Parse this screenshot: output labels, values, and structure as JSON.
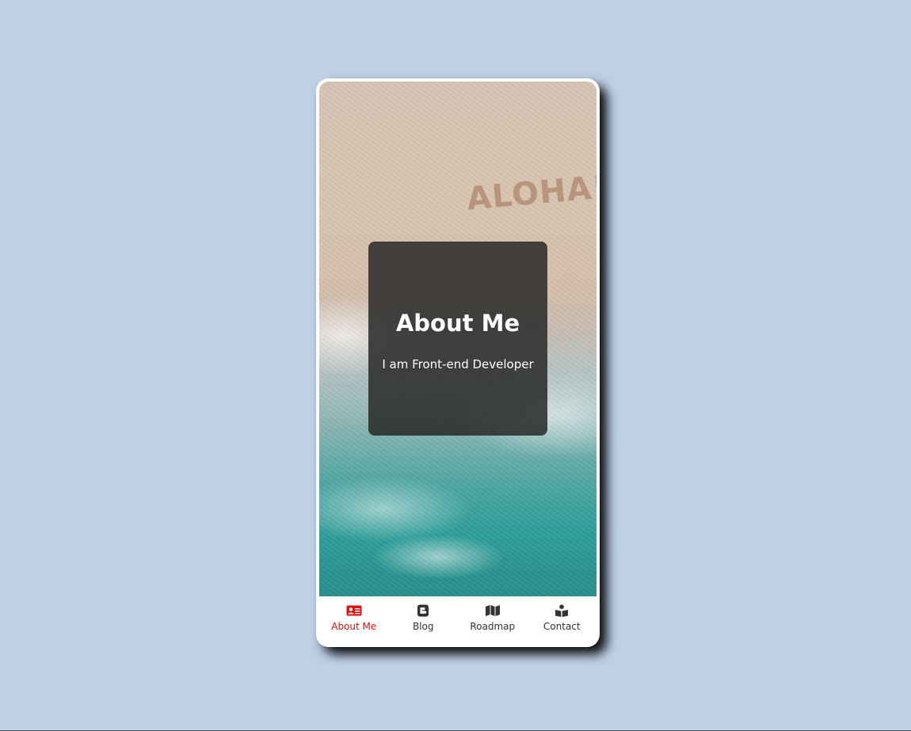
{
  "background_color": "#bfd0e6",
  "accent_color": "#e01010",
  "hero": {
    "image_text": "ALOHA!",
    "title": "About Me",
    "subtitle": "I am Front-end Developer"
  },
  "bottom_nav": {
    "items": [
      {
        "label": "About Me",
        "icon": "id-card-icon",
        "active": true
      },
      {
        "label": "Blog",
        "icon": "blogger-icon",
        "active": false
      },
      {
        "label": "Roadmap",
        "icon": "map-icon",
        "active": false
      },
      {
        "label": "Contact",
        "icon": "contact-book-icon",
        "active": false
      }
    ]
  }
}
